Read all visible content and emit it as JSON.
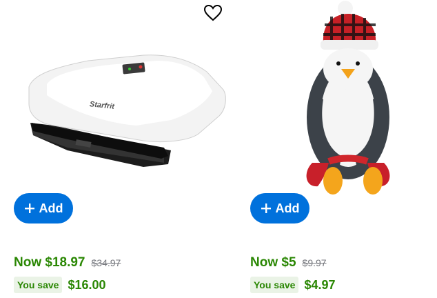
{
  "products": [
    {
      "image_alt": "Starfrit grill",
      "brand_text": "Starfrit",
      "add_label": "Add",
      "price_now": "Now $18.97",
      "price_was": "$34.97",
      "save_label": "You save",
      "save_amount": "$16.00"
    },
    {
      "image_alt": "Penguin plush toy",
      "add_label": "Add",
      "price_now": "Now $5",
      "price_was": "$9.97",
      "save_label": "You save",
      "save_amount": "$4.97"
    }
  ],
  "icons": {
    "favorite": "heart-icon",
    "add": "plus-icon"
  },
  "colors": {
    "accent": "#0071dc",
    "price_green": "#2a8703",
    "save_badge_bg": "#eaf3e6",
    "was_gray": "#74767c"
  }
}
